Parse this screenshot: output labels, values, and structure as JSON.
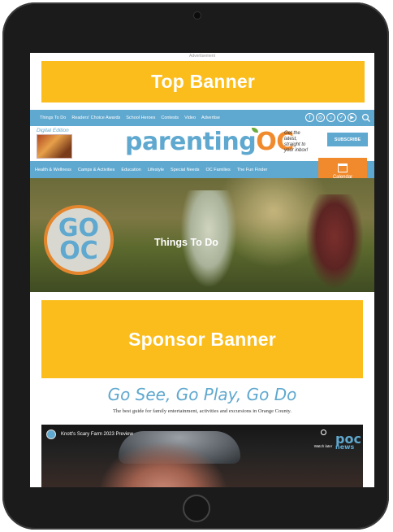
{
  "ad": {
    "label": "Advertisement"
  },
  "top_banner": {
    "label": "Top Banner"
  },
  "top_nav": {
    "items": [
      "Things To Do",
      "Readers' Choice Awards",
      "School Heroes",
      "Contests",
      "Video",
      "Advertise"
    ],
    "social_icons": [
      "facebook-icon",
      "instagram-icon",
      "tiktok-icon",
      "twitter-icon",
      "youtube-icon"
    ]
  },
  "header": {
    "digital_edition_label": "Digital Edition",
    "logo_main": "parenting",
    "logo_accent": "OC",
    "tagline": "Get the latest, straight to your inbox!",
    "subscribe_label": "SUBSCRIBE"
  },
  "category_nav": {
    "items": [
      "Health & Wellness",
      "Camps & Activities",
      "Education",
      "Lifestyle",
      "Special Needs",
      "OC Families",
      "The Fun Finder"
    ],
    "calendar_label": "Calendar"
  },
  "hero": {
    "logo_line1": "GO",
    "logo_line2": "OC",
    "title": "Things To Do"
  },
  "sponsor_banner": {
    "label": "Sponsor Banner"
  },
  "content": {
    "heading": "Go See, Go Play, Go Do",
    "description": "The best guide for family entertainment, activities and excursions in Orange County."
  },
  "video": {
    "title": "Knott's Scary Farm 2023 Preview",
    "watch_later_label": "Watch later",
    "brand_logo": "poc",
    "brand_sub": "news"
  },
  "colors": {
    "banner_yellow": "#fbbd1c",
    "nav_blue": "#5fa8cf",
    "accent_orange": "#f08a2c",
    "device_frame": "#1b1b1b"
  }
}
